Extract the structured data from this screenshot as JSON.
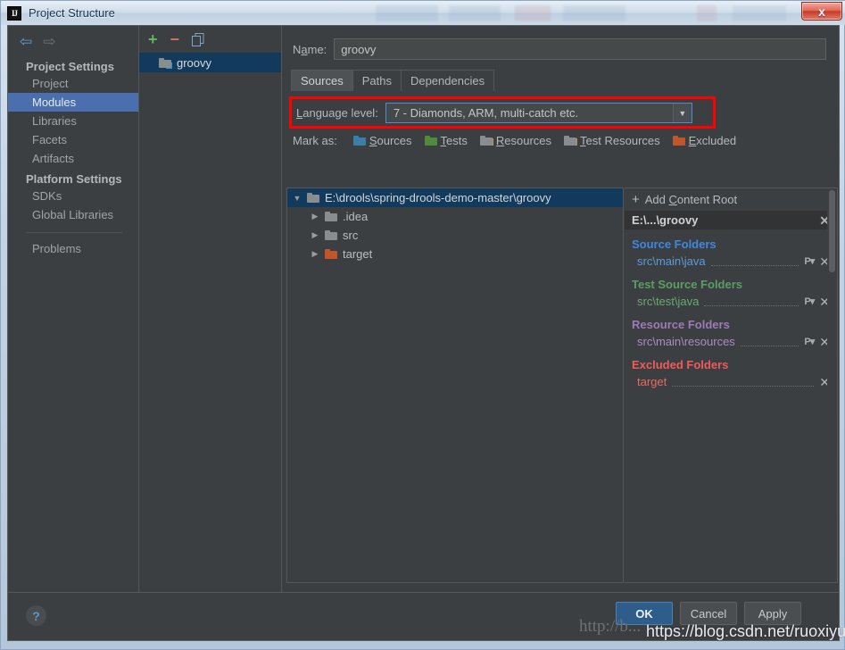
{
  "window": {
    "title": "Project Structure",
    "app_icon": "IJ",
    "close_label": "x"
  },
  "nav": {
    "back_icon": "⇦",
    "forward_icon": "⇨"
  },
  "sidebar": {
    "groups": [
      {
        "title": "Project Settings",
        "items": [
          {
            "label": "Project",
            "selected": false
          },
          {
            "label": "Modules",
            "selected": true
          },
          {
            "label": "Libraries",
            "selected": false
          },
          {
            "label": "Facets",
            "selected": false
          },
          {
            "label": "Artifacts",
            "selected": false
          }
        ]
      },
      {
        "title": "Platform Settings",
        "items": [
          {
            "label": "SDKs",
            "selected": false
          },
          {
            "label": "Global Libraries",
            "selected": false
          }
        ]
      }
    ],
    "problems_label": "Problems"
  },
  "modules_panel": {
    "toolbar": {
      "add_label": "+",
      "remove_label": "−",
      "copy_label": "copy-icon"
    },
    "items": [
      {
        "label": "groovy",
        "selected": true
      }
    ]
  },
  "main": {
    "name_label_pre": "N",
    "name_label_key": "a",
    "name_label_post": "me:",
    "name_value": "groovy",
    "name_placeholder": "",
    "tabs": [
      {
        "label": "Sources",
        "active": true
      },
      {
        "label": "Paths",
        "active": false
      },
      {
        "label": "Dependencies",
        "active": false
      }
    ],
    "language_level": {
      "label_key": "L",
      "label_rest": "anguage level:",
      "value": "7 - Diamonds, ARM, multi-catch etc.",
      "arrow": "▼",
      "highlight_color": "#fe0000"
    },
    "mark_as": {
      "label": "Mark as:",
      "buttons": [
        {
          "key": "S",
          "rest": "ources",
          "icon": "folder-blue-icon",
          "color": "#3b7ea8"
        },
        {
          "key": "T",
          "rest": "ests",
          "icon": "folder-green-icon",
          "color": "#4f8a3d"
        },
        {
          "key": "R",
          "rest": "esources",
          "icon": "folder-resources-icon",
          "color": "#8a8d8f"
        },
        {
          "key": "T",
          "rest": "est Resources",
          "icon": "folder-test-resources-icon",
          "color": "#c0562a"
        },
        {
          "key": "E",
          "rest": "xcluded",
          "icon": "folder-orange-icon",
          "color": "#c0562a"
        }
      ]
    },
    "tree": [
      {
        "label": "E:\\drools\\spring-drools-demo-master\\groovy",
        "expanded": true,
        "depth": 0,
        "icon": "folder-gray-icon",
        "selected": true
      },
      {
        "label": ".idea",
        "expanded": false,
        "depth": 1,
        "icon": "folder-gray-icon",
        "selected": false
      },
      {
        "label": "src",
        "expanded": false,
        "depth": 1,
        "icon": "folder-gray-icon",
        "selected": false
      },
      {
        "label": "target",
        "expanded": false,
        "depth": 1,
        "icon": "folder-orange-icon",
        "selected": false
      }
    ],
    "roots": {
      "add_content_root": {
        "prefix": "Add ",
        "key": "C",
        "rest": "ontent Root",
        "plus": "+"
      },
      "root_path": "E:\\...\\groovy",
      "close_icon": "✕",
      "categories": [
        {
          "title": "Source Folders",
          "title_class": "cat-src",
          "path_class": "p-src",
          "entries": [
            {
              "path": "src\\main\\java",
              "has_package_prefix": true,
              "package_icon": "P",
              "close_icon": "✕"
            }
          ]
        },
        {
          "title": "Test Source Folders",
          "title_class": "cat-test",
          "path_class": "p-test",
          "entries": [
            {
              "path": "src\\test\\java",
              "has_package_prefix": true,
              "package_icon": "P",
              "close_icon": "✕"
            }
          ]
        },
        {
          "title": "Resource Folders",
          "title_class": "cat-res",
          "path_class": "p-res",
          "entries": [
            {
              "path": "src\\main\\resources",
              "has_package_prefix": true,
              "package_icon": "P",
              "close_icon": "✕"
            }
          ]
        },
        {
          "title": "Excluded Folders",
          "title_class": "cat-excl",
          "path_class": "p-excl",
          "entries": [
            {
              "path": "target",
              "has_package_prefix": false,
              "package_icon": "",
              "close_icon": "✕"
            }
          ]
        }
      ]
    }
  },
  "footer": {
    "help_label": "?",
    "ok_label": "OK",
    "cancel_label": "Cancel",
    "apply_label": "Apply"
  },
  "watermarks": {
    "primary": "https://blog.csdn.net/ruoxiyun",
    "secondary": "http://b..."
  }
}
